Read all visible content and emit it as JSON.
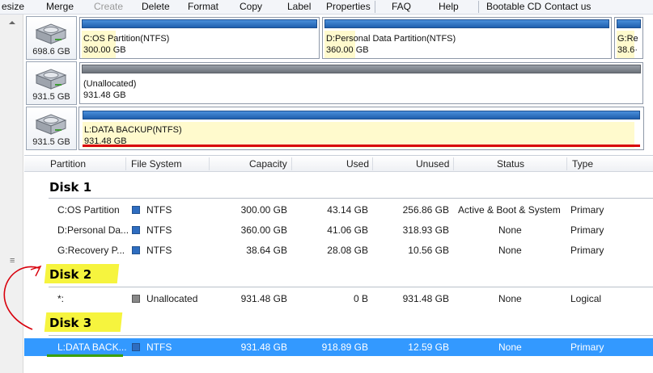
{
  "toolbar": {
    "items": [
      {
        "label": "esize",
        "enabled": true
      },
      {
        "label": "Merge",
        "enabled": true
      },
      {
        "label": "Create",
        "enabled": false
      },
      {
        "label": "Delete",
        "enabled": true
      },
      {
        "label": "Format",
        "enabled": true
      },
      {
        "label": "Copy",
        "enabled": true
      },
      {
        "label": "Label",
        "enabled": true
      },
      {
        "label": "Properties",
        "enabled": true
      },
      {
        "label": "FAQ",
        "enabled": true
      },
      {
        "label": "Help",
        "enabled": true
      },
      {
        "label": "Bootable CD",
        "enabled": true
      },
      {
        "label": "Contact us",
        "enabled": true
      }
    ]
  },
  "disk_map": {
    "disks": [
      {
        "size": "698.6 GB",
        "partitions": [
          {
            "name": "C:OS Partition(NTFS)",
            "size": "300.00 GB"
          },
          {
            "name": "D:Personal Data Partition(NTFS)",
            "size": "360.00 GB"
          },
          {
            "name": "G:Re",
            "size": "38.6·"
          }
        ]
      },
      {
        "size": "931.5 GB",
        "partitions": [
          {
            "name": "(Unallocated)",
            "size": "931.48 GB"
          }
        ]
      },
      {
        "size": "931.5 GB",
        "partitions": [
          {
            "name": "L:DATA BACKUP(NTFS)",
            "size": "931.48 GB"
          }
        ]
      }
    ]
  },
  "list": {
    "columns": [
      "Partition",
      "File System",
      "Capacity",
      "Used",
      "Unused",
      "Status",
      "Type"
    ],
    "groups": [
      {
        "title": "Disk 1",
        "rows": [
          {
            "partition": "C:OS Partition",
            "fs": "NTFS",
            "capacity": "300.00 GB",
            "used": "43.14 GB",
            "unused": "256.86 GB",
            "status": "Active & Boot & System",
            "type": "Primary"
          },
          {
            "partition": "D:Personal Da...",
            "fs": "NTFS",
            "capacity": "360.00 GB",
            "used": "41.06 GB",
            "unused": "318.93 GB",
            "status": "None",
            "type": "Primary"
          },
          {
            "partition": "G:Recovery P...",
            "fs": "NTFS",
            "capacity": "38.64 GB",
            "used": "28.08 GB",
            "unused": "10.56 GB",
            "status": "None",
            "type": "Primary"
          }
        ]
      },
      {
        "title": "Disk 2",
        "rows": [
          {
            "partition": "*:",
            "fs": "Unallocated",
            "capacity": "931.48 GB",
            "used": "0 B",
            "unused": "931.48 GB",
            "status": "None",
            "type": "Logical"
          }
        ]
      },
      {
        "title": "Disk 3",
        "rows": [
          {
            "partition": "L:DATA BACK...",
            "fs": "NTFS",
            "capacity": "931.48 GB",
            "used": "918.89 GB",
            "unused": "12.59 GB",
            "status": "None",
            "type": "Primary"
          }
        ]
      }
    ]
  },
  "colors": {
    "selection": "#3399ff",
    "partition_bar": "#1f5fae",
    "used_fill": "#fffacd",
    "highlight": "#f4f21c",
    "annotation_red": "#d8000c"
  }
}
